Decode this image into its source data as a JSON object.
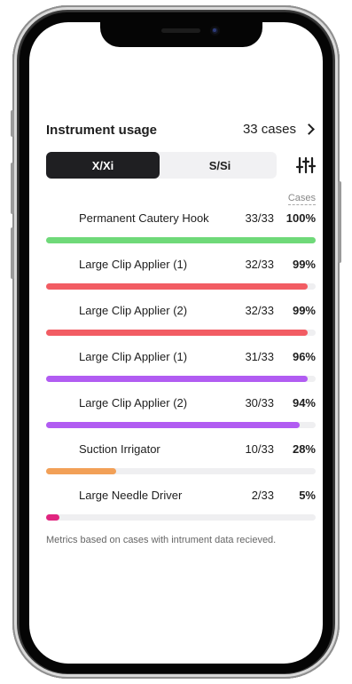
{
  "header": {
    "title": "Instrument usage",
    "cases_label": "33 cases"
  },
  "segmented": {
    "options": [
      "X/Xi",
      "S/Si"
    ],
    "selected": "X/Xi"
  },
  "list": {
    "column_header": "Cases",
    "rows": [
      {
        "name": "Permanent Cautery Hook",
        "count": "33/33",
        "percent": "100%",
        "fraction": 1.0,
        "color": "#6fd979"
      },
      {
        "name": "Large Clip Applier (1)",
        "count": "32/33",
        "percent": "99%",
        "fraction": 0.97,
        "color": "#f25c63"
      },
      {
        "name": "Large Clip Applier (2)",
        "count": "32/33",
        "percent": "99%",
        "fraction": 0.97,
        "color": "#f25c63"
      },
      {
        "name": "Large Clip Applier (1)",
        "count": "31/33",
        "percent": "96%",
        "fraction": 0.97,
        "color": "#b15cf2"
      },
      {
        "name": "Large Clip Applier (2)",
        "count": "30/33",
        "percent": "94%",
        "fraction": 0.94,
        "color": "#b15cf2"
      },
      {
        "name": "Suction Irrigator",
        "count": "10/33",
        "percent": "28%",
        "fraction": 0.26,
        "color": "#f2a057"
      },
      {
        "name": "Large Needle Driver",
        "count": "2/33",
        "percent": "5%",
        "fraction": 0.05,
        "color": "#e0257f"
      }
    ]
  },
  "footnote": "Metrics based on cases with intrument data recieved.",
  "icons": {
    "chevron": "chevron-right-icon",
    "filter": "sliders-icon"
  }
}
